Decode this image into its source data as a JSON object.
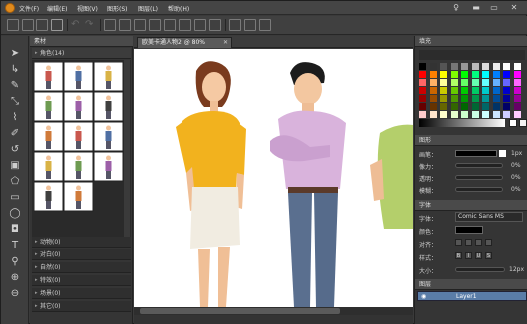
{
  "menu": {
    "items": [
      "文件(F)",
      "编辑(E)",
      "视图(V)",
      "图形(S)",
      "图层(L)",
      "帮助(H)"
    ],
    "window_buttons": {
      "pin": "♀",
      "minimize": "▬",
      "maximize": "▭",
      "close": "✕"
    }
  },
  "material_panel": {
    "title": "素材",
    "active_category": "角色(14)",
    "categories": [
      "动物(0)",
      "对白(0)",
      "自然(0)",
      "特效(0)",
      "场景(0)",
      "其它(0)"
    ]
  },
  "canvas_tab": {
    "label": "欧美卡通人物2 @ 80%"
  },
  "fill_panel": {
    "title": "填充",
    "swatches": [
      "#000000",
      "#333333",
      "#555555",
      "#777777",
      "#999999",
      "#bbbbbb",
      "#dddddd",
      "#eeeeee",
      "#ffffff",
      "#ffffff",
      "#ff0000",
      "#ff8000",
      "#ffff00",
      "#80ff00",
      "#00ff00",
      "#00ff80",
      "#00ffff",
      "#0080ff",
      "#0000ff",
      "#ff00ff",
      "#ff6666",
      "#ffb266",
      "#ffff99",
      "#b2ff66",
      "#66ff66",
      "#66ffb2",
      "#66ffff",
      "#66b2ff",
      "#6666ff",
      "#ff66ff",
      "#cc0000",
      "#cc6600",
      "#cccc00",
      "#66cc00",
      "#00cc00",
      "#00cc66",
      "#00cccc",
      "#0066cc",
      "#0000cc",
      "#cc00cc",
      "#990000",
      "#994c00",
      "#999900",
      "#4c9900",
      "#009900",
      "#00994c",
      "#009999",
      "#004c99",
      "#000099",
      "#990099",
      "#660000",
      "#663300",
      "#666600",
      "#336600",
      "#006600",
      "#006633",
      "#006666",
      "#003366",
      "#000066",
      "#660066",
      "#ffcccc",
      "#ffe5cc",
      "#ffffcc",
      "#e5ffcc",
      "#ccffcc",
      "#ccffe5",
      "#ccffff",
      "#cce5ff",
      "#ccccff",
      "#ffccff"
    ]
  },
  "shape_panel": {
    "title": "图形",
    "rows": [
      {
        "label": "画笔：",
        "value": "1px"
      },
      {
        "label": "像力：",
        "value": "0%"
      },
      {
        "label": "透明：",
        "value": "0%"
      },
      {
        "label": "模糊：",
        "value": "0%"
      }
    ]
  },
  "font_panel": {
    "title": "字体",
    "font_label": "字体：",
    "font_value": "Comic Sans MS",
    "color_label": "颜色：",
    "align_label": "对齐：",
    "style_label": "样式：",
    "style_buttons": [
      "B",
      "I",
      "U",
      "S"
    ],
    "size_label": "大小：",
    "size_value": "12px"
  },
  "layer_panel": {
    "title": "图层",
    "layer_name": "Layer1"
  }
}
